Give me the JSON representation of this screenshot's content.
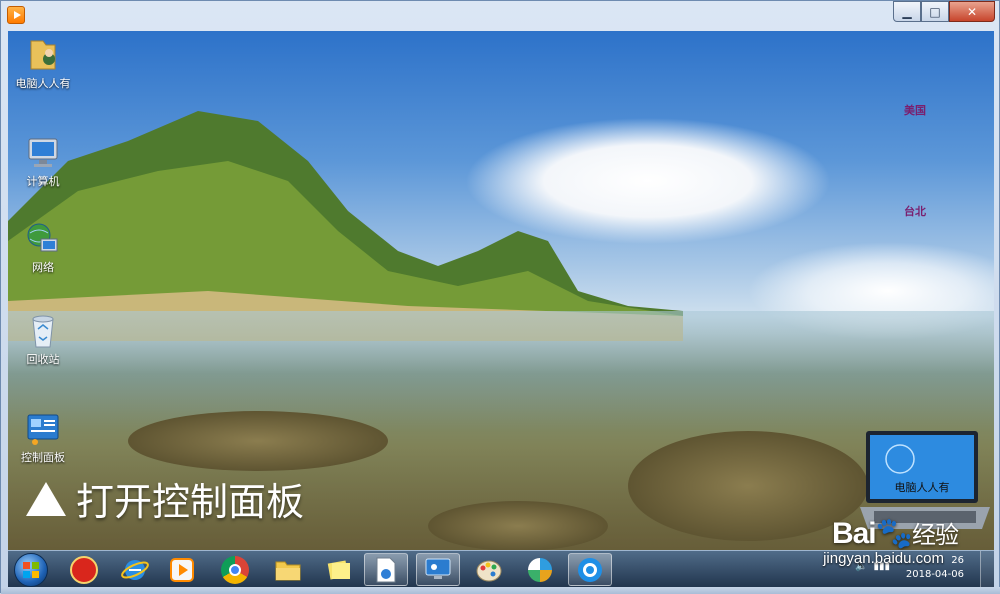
{
  "window": {
    "app_icon": "media-player-icon",
    "buttons": {
      "minimize": "▁",
      "maximize": "□",
      "close": "✕"
    }
  },
  "desktop": {
    "icons": [
      {
        "label": "电脑人人有",
        "icon": "user-folder-icon"
      },
      {
        "label": "计算机",
        "icon": "computer-icon"
      },
      {
        "label": "网络",
        "icon": "network-icon"
      },
      {
        "label": "回收站",
        "icon": "recycle-bin-icon"
      },
      {
        "label": "控制面板",
        "icon": "control-panel-icon"
      }
    ],
    "map_labels": {
      "label_1": "美国",
      "label_2": "台北"
    },
    "caption": "打开控制面板",
    "laptop_text": "电脑人人有"
  },
  "watermark": {
    "brand": "Bai",
    "brand_suffix": "经验",
    "url": "jingyan.baidu.com"
  },
  "taskbar": {
    "items": [
      {
        "icon": "chinese-chess-icon"
      },
      {
        "icon": "internet-explorer-icon"
      },
      {
        "icon": "media-player-icon"
      },
      {
        "icon": "chrome-icon"
      },
      {
        "icon": "file-explorer-icon"
      },
      {
        "icon": "sticky-notes-icon"
      },
      {
        "icon": "document-icon"
      },
      {
        "icon": "remote-desktop-icon"
      },
      {
        "icon": "paint-icon"
      },
      {
        "icon": "pinwheel-icon"
      },
      {
        "icon": "browser-circle-icon"
      }
    ],
    "tray": {
      "time": "26",
      "date": "2018-04-06"
    }
  },
  "colors": {
    "taskbar": "#1f3a5a",
    "close_button": "#c7452c",
    "map_label": "#7a1f6e"
  }
}
